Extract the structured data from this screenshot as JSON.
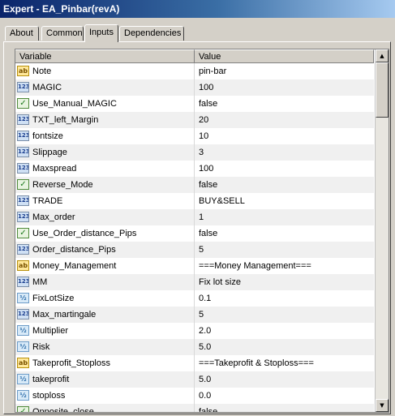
{
  "window": {
    "title": "Expert - EA_Pinbar(revA)"
  },
  "tabs": [
    {
      "label": "About",
      "active": false
    },
    {
      "label": "Common",
      "active": false
    },
    {
      "label": "Inputs",
      "active": true
    },
    {
      "label": "Dependencies",
      "active": false
    }
  ],
  "grid": {
    "columns": {
      "variable": "Variable",
      "value": "Value"
    },
    "rows": [
      {
        "type": "string",
        "icon_text": "ab",
        "name": "Note",
        "value": "pin-bar"
      },
      {
        "type": "int",
        "icon_text": "123",
        "name": "MAGIC",
        "value": "100"
      },
      {
        "type": "bool",
        "icon_text": "✓",
        "name": "Use_Manual_MAGIC",
        "value": "false"
      },
      {
        "type": "int",
        "icon_text": "123",
        "name": "TXT_left_Margin",
        "value": "20"
      },
      {
        "type": "int",
        "icon_text": "123",
        "name": "fontsize",
        "value": "10"
      },
      {
        "type": "int",
        "icon_text": "123",
        "name": "Slippage",
        "value": "3"
      },
      {
        "type": "int",
        "icon_text": "123",
        "name": "Maxspread",
        "value": "100"
      },
      {
        "type": "bool",
        "icon_text": "✓",
        "name": "Reverse_Mode",
        "value": "false"
      },
      {
        "type": "int",
        "icon_text": "123",
        "name": "TRADE",
        "value": "BUY&SELL"
      },
      {
        "type": "int",
        "icon_text": "123",
        "name": "Max_order",
        "value": "1"
      },
      {
        "type": "bool",
        "icon_text": "✓",
        "name": "Use_Order_distance_Pips",
        "value": "false"
      },
      {
        "type": "int",
        "icon_text": "123",
        "name": "Order_distance_Pips",
        "value": "5"
      },
      {
        "type": "string",
        "icon_text": "ab",
        "name": "Money_Management",
        "value": "===Money Management==="
      },
      {
        "type": "int",
        "icon_text": "123",
        "name": "MM",
        "value": "Fix lot size"
      },
      {
        "type": "double",
        "icon_text": "½",
        "name": "FixLotSize",
        "value": "0.1"
      },
      {
        "type": "int",
        "icon_text": "123",
        "name": "Max_martingale",
        "value": "5"
      },
      {
        "type": "double",
        "icon_text": "½",
        "name": "Multiplier",
        "value": "2.0"
      },
      {
        "type": "double",
        "icon_text": "½",
        "name": "Risk",
        "value": "5.0"
      },
      {
        "type": "string",
        "icon_text": "ab",
        "name": "Takeprofit_Stoploss",
        "value": "===Takeprofit & Stoploss==="
      },
      {
        "type": "double",
        "icon_text": "½",
        "name": "takeprofit",
        "value": "5.0"
      },
      {
        "type": "double",
        "icon_text": "½",
        "name": "stoploss",
        "value": "0.0"
      },
      {
        "type": "bool",
        "icon_text": "✓",
        "name": "Opposite_close",
        "value": "false"
      }
    ]
  },
  "scrollbar": {
    "up_arrow": "▲",
    "down_arrow": "▼"
  }
}
